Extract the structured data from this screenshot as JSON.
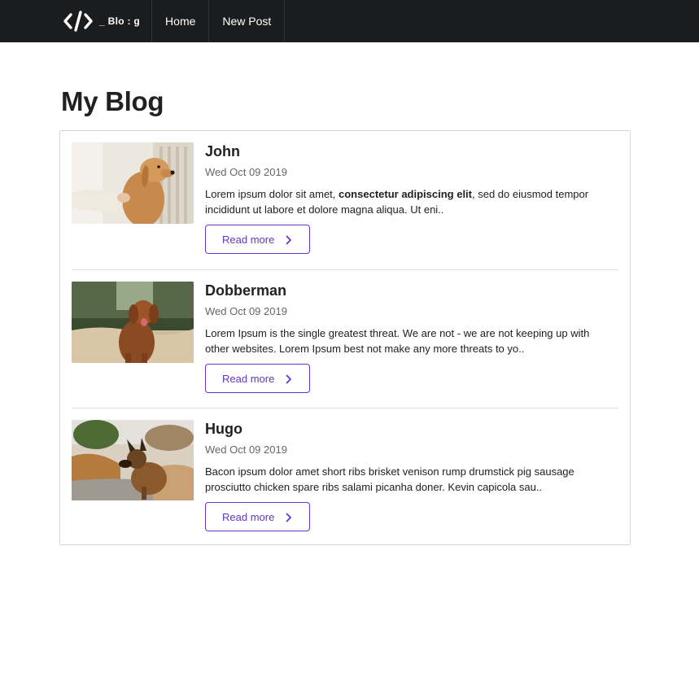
{
  "navbar": {
    "brand_text": "_ Blo : g",
    "items": [
      {
        "label": "Home"
      },
      {
        "label": "New Post"
      }
    ]
  },
  "page": {
    "title": "My Blog"
  },
  "posts": [
    {
      "title": "John",
      "date": "Wed Oct 09 2019",
      "excerpt_before": "Lorem ipsum dolor sit amet, ",
      "excerpt_bold": "consectetur adipiscing elit",
      "excerpt_after": ", sed do eiusmod tempor incididunt ut labore et dolore magna aliqua. Ut eni..",
      "button_label": "Read more",
      "image": "golden-retriever-photo"
    },
    {
      "title": "Dobberman",
      "date": "Wed Oct 09 2019",
      "excerpt": "Lorem Ipsum is the single greatest threat. We are not - we are not keeping up with other websites. Lorem Ipsum best not make any more threats to yo..",
      "button_label": "Read more",
      "image": "brown-dog-sitting-photo"
    },
    {
      "title": "Hugo",
      "date": "Wed Oct 09 2019",
      "excerpt": "Bacon ipsum dolor amet short ribs brisket venison rump drumstick pig sausage prosciutto chicken spare ribs salami picanha doner. Kevin capicola sau..",
      "button_label": "Read more",
      "image": "german-shepherd-photo"
    }
  ],
  "colors": {
    "navbar_bg": "#1b1c1d",
    "accent": "#6435c9",
    "text": "#212121"
  }
}
